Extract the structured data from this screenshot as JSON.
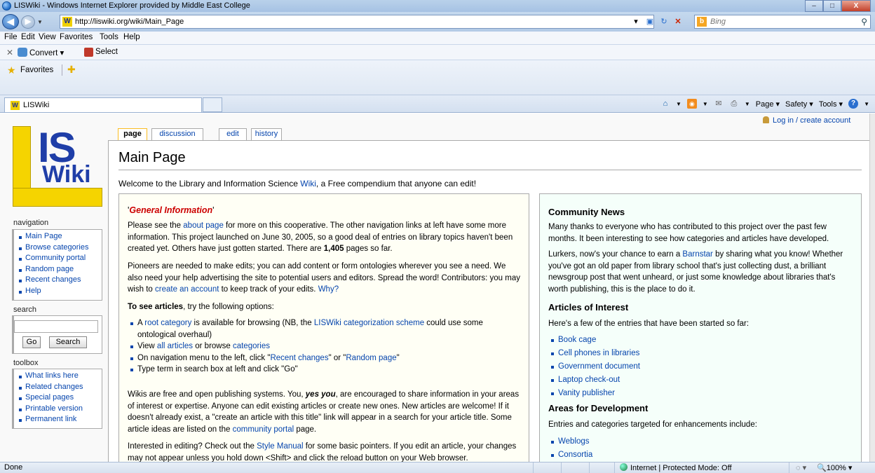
{
  "window": {
    "title": "LISWiki - Windows Internet Explorer provided by Middle East College",
    "minimize": "–",
    "maximize": "□",
    "close": "X"
  },
  "address": {
    "url": "http://liswiki.org/wiki/Main_Page",
    "search_placeholder": "Bing"
  },
  "menu": [
    "File",
    "Edit",
    "View",
    "Favorites",
    "Tools",
    "Help"
  ],
  "command_bar": {
    "convert": "Convert ▾",
    "select": "Select"
  },
  "favorites_bar": {
    "label": "Favorites"
  },
  "tab": {
    "label": "LISWiki"
  },
  "toolbar_right": {
    "page": "Page ▾",
    "safety": "Safety ▾",
    "tools": "Tools ▾"
  },
  "sidebar": {
    "logo_ls": "IS",
    "logo_wiki": "Wiki",
    "navigation_heading": "navigation",
    "navigation": [
      "Main Page",
      "Browse categories",
      "Community portal",
      "Random page",
      "Recent changes",
      "Help"
    ],
    "search_heading": "search",
    "go_label": "Go",
    "search_label": "Search",
    "toolbox_heading": "toolbox",
    "toolbox": [
      "What links here",
      "Related changes",
      "Special pages",
      "Printable version",
      "Permanent link"
    ]
  },
  "login": "Log in / create account",
  "page_tabs": [
    "page",
    "discussion",
    "edit",
    "history"
  ],
  "page_title": "Main Page",
  "welcome": {
    "before": "Welcome to the Library and Information Science ",
    "link": "Wiki",
    "after": ", a Free compendium that anyone can edit!"
  },
  "general_info": {
    "title": "General Information",
    "p1": {
      "a": "Please see the ",
      "link1": "about page",
      "b": " for more on this cooperative. The other navigation links at left have some more information. This project launched on June 30, 2005, so a good deal of entries on library topics haven't been created yet. Others have just gotten started. There are ",
      "count": "1,405",
      "c": " pages so far."
    },
    "p2": {
      "a": "Pioneers are needed to make edits; you can add content or form ontologies wherever you see a need. We also need your help advertising the site to potential users and editors. Spread the word! Contributors: you may wish to ",
      "link1": "create an account",
      "b": " to keep track of your edits. ",
      "link2": "Why?"
    },
    "to_see_bold": "To see articles",
    "to_see_rest": ", try the following options:",
    "bullets": [
      {
        "a": "A ",
        "link1": "root category",
        "b": " is available for browsing (NB, the ",
        "link2": "LISWiki categorization scheme",
        "c": " could use some ontological overhaul)"
      },
      {
        "a": "View ",
        "link1": "all articles",
        "b": " or browse ",
        "link2": "categories",
        "c": ""
      },
      {
        "a": "On navigation menu to the left, click \"",
        "link1": "Recent changes",
        "b": "\" or \"",
        "link2": "Random page",
        "c": "\""
      },
      {
        "a": "Type term in search box at left and click \"Go\"",
        "link1": "",
        "b": "",
        "link2": "",
        "c": ""
      }
    ],
    "p3": {
      "a": "Wikis are free and open publishing systems. You, ",
      "em": "yes you",
      "b": ", are encouraged to share information in your areas of interest or expertise. Anyone can edit existing articles or create new ones. New articles are welcome! If it doesn't already exist, a \"create an article with this title\" link will appear in a search for your article title. Some article ideas are listed on the ",
      "link1": "community portal",
      "c": " page."
    },
    "p4": {
      "a": "Interested in editing? Check out the ",
      "link1": "Style Manual",
      "b": " for some basic pointers. If you edit an article, your changes may not appear unless you hold down <Shift> and click the reload button on your Web browser."
    }
  },
  "community": {
    "news_heading": "Community News",
    "news_p1": "Many thanks to everyone who has contributed to this project over the past few months. It been interesting to see how categories and articles have developed.",
    "news_p2": {
      "a": "Lurkers, now's your chance to earn a ",
      "link1": "Barnstar",
      "b": " by sharing what you know! Whether you've got an old paper from library school that's just collecting dust, a brilliant newsgroup post that went unheard, or just some knowledge about libraries that's worth publishing, this is the place to do it."
    },
    "articles_heading": "Articles of Interest",
    "articles_intro": "Here's a few of the entries that have been started so far:",
    "articles": [
      "Book cage",
      "Cell phones in libraries",
      "Government document",
      "Laptop check-out",
      "Vanity publisher"
    ],
    "dev_heading": "Areas for Development",
    "dev_intro": "Entries and categories targeted for enhancements include:",
    "dev": [
      "Weblogs",
      "Consortia"
    ]
  },
  "status": {
    "left": "Done",
    "zone": "Internet | Protected Mode: Off",
    "zoom": "100%  ▾"
  }
}
